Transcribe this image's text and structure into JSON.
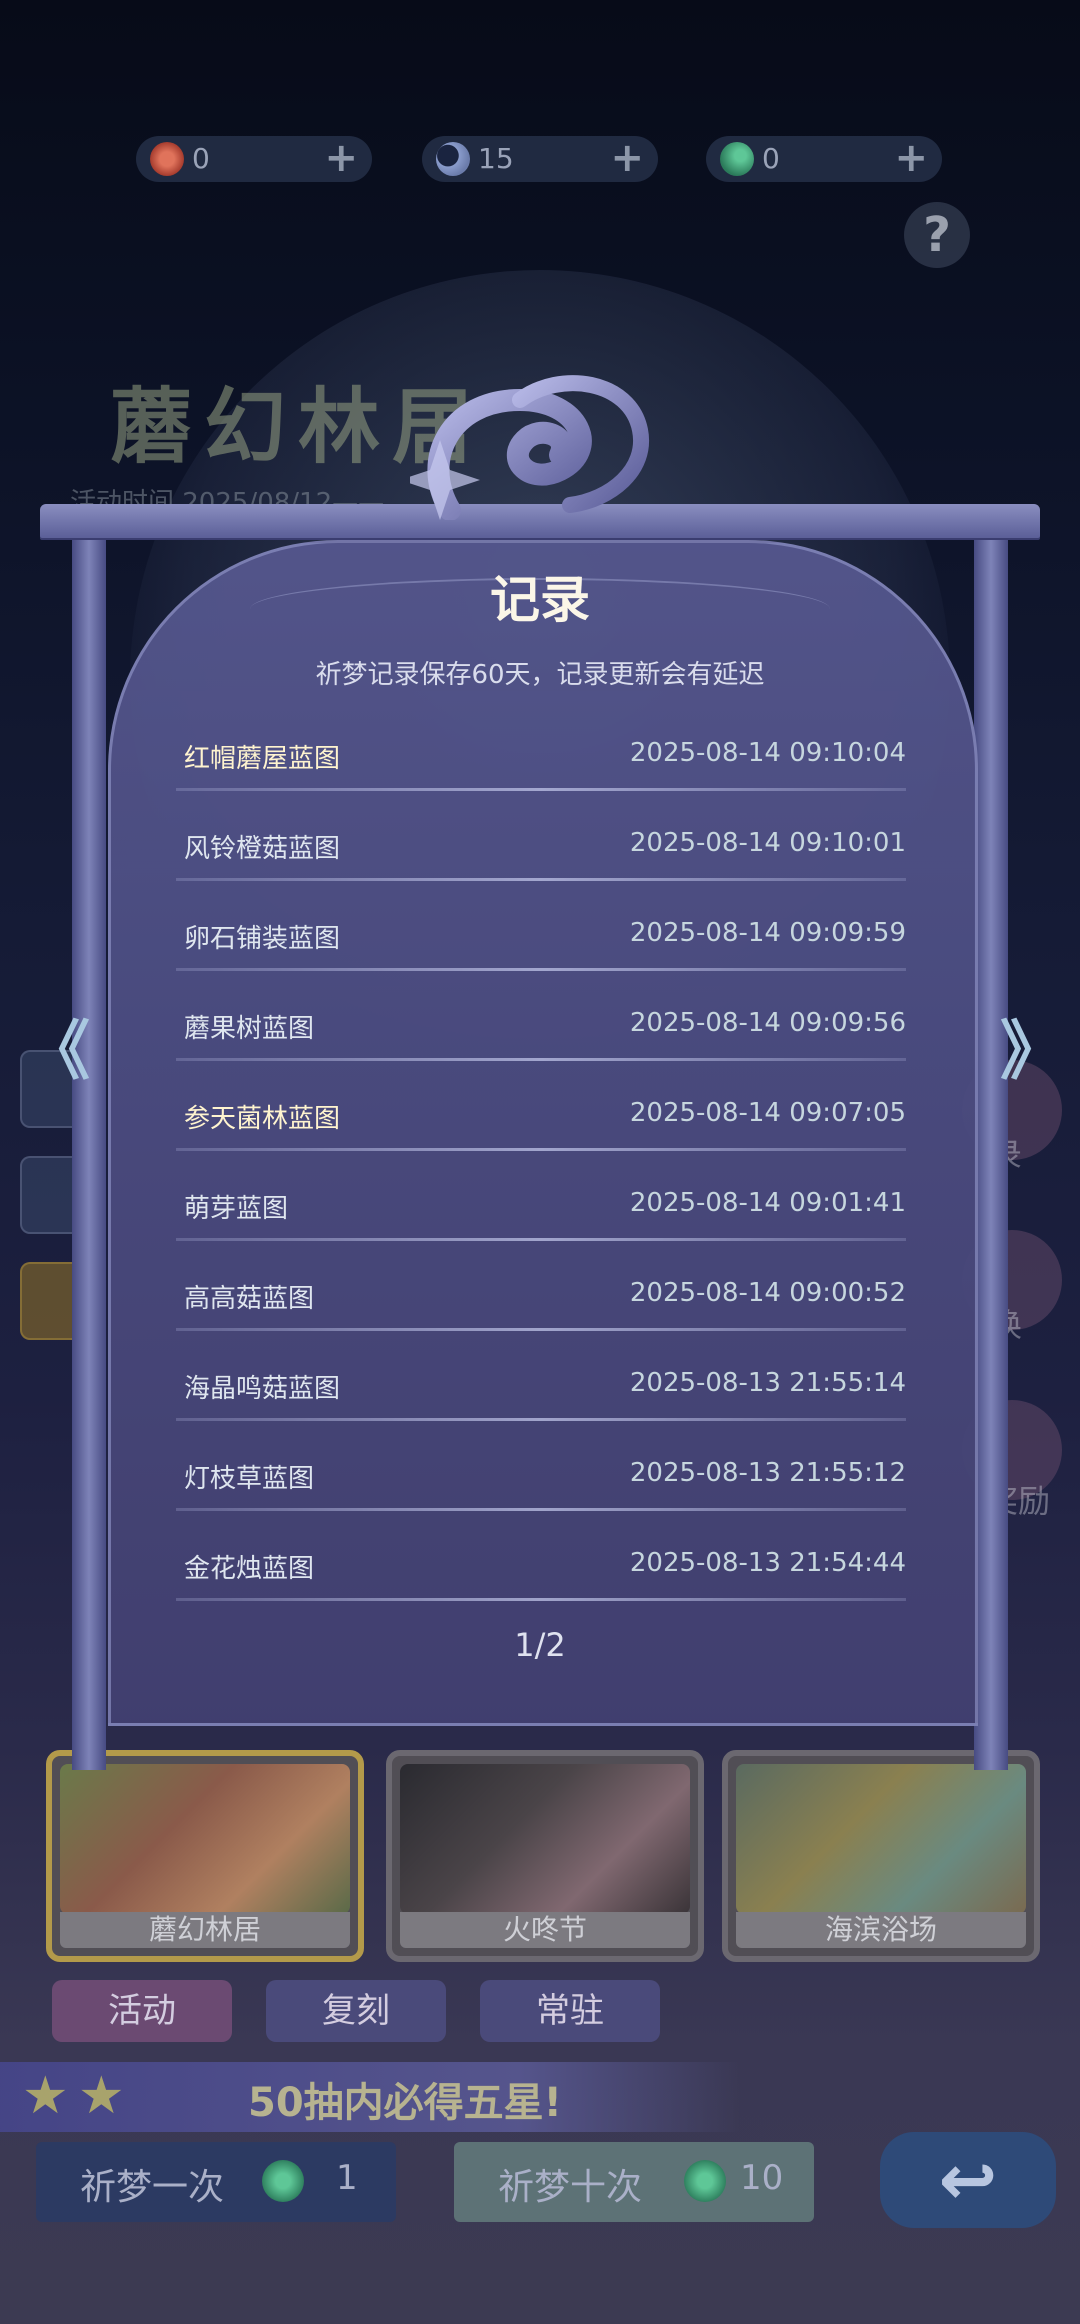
{
  "currencies": [
    {
      "icon": "red-flower-icon",
      "color": "#c9523e",
      "value": "0"
    },
    {
      "icon": "moon-icon",
      "color": "#7d8fb8",
      "value": "15"
    },
    {
      "icon": "green-leaf-icon",
      "color": "#3f9a72",
      "value": "0"
    }
  ],
  "help_label": "?",
  "background": {
    "event_title": "蘑幻林居",
    "event_time": "活动时间 2025/08/12——"
  },
  "modal": {
    "title": "记录",
    "subtitle": "祈梦记录保存60天，记录更新会有延迟",
    "records": [
      {
        "name": "红帽蘑屋蓝图",
        "time": "2025-08-14 09:10:04",
        "highlight": true
      },
      {
        "name": "风铃橙菇蓝图",
        "time": "2025-08-14 09:10:01",
        "highlight": false
      },
      {
        "name": "卵石铺装蓝图",
        "time": "2025-08-14 09:09:59",
        "highlight": false
      },
      {
        "name": "蘑果树蓝图",
        "time": "2025-08-14 09:09:56",
        "highlight": false
      },
      {
        "name": "参天菌林蓝图",
        "time": "2025-08-14 09:07:05",
        "highlight": true
      },
      {
        "name": "萌芽蓝图",
        "time": "2025-08-14 09:01:41",
        "highlight": false
      },
      {
        "name": "高高菇蓝图",
        "time": "2025-08-14 09:00:52",
        "highlight": false
      },
      {
        "name": "海晶鸣菇蓝图",
        "time": "2025-08-13 21:55:14",
        "highlight": false
      },
      {
        "name": "灯枝草蓝图",
        "time": "2025-08-13 21:55:12",
        "highlight": false
      },
      {
        "name": "金花烛蓝图",
        "time": "2025-08-13 21:54:44",
        "highlight": false
      }
    ],
    "page": "1/2",
    "prev_label": "《",
    "next_label": "》"
  },
  "side_right": [
    "录",
    "换",
    "奖励"
  ],
  "pools": [
    {
      "label": "蘑幻林居",
      "selected": true
    },
    {
      "label": "火咚节",
      "selected": false
    },
    {
      "label": "海滨浴场",
      "selected": false
    }
  ],
  "tabs": [
    {
      "label": "活动",
      "color": "#6b4a72"
    },
    {
      "label": "复刻",
      "color": "#4a4a7a"
    },
    {
      "label": "常驻",
      "color": "#4a4a7a"
    }
  ],
  "banner_text": "50抽内必得五星!",
  "pray_once": {
    "label": "祈梦一次",
    "cost": "1"
  },
  "pray_ten": {
    "label": "祈梦十次",
    "cost": "10"
  },
  "back_label": "↩"
}
